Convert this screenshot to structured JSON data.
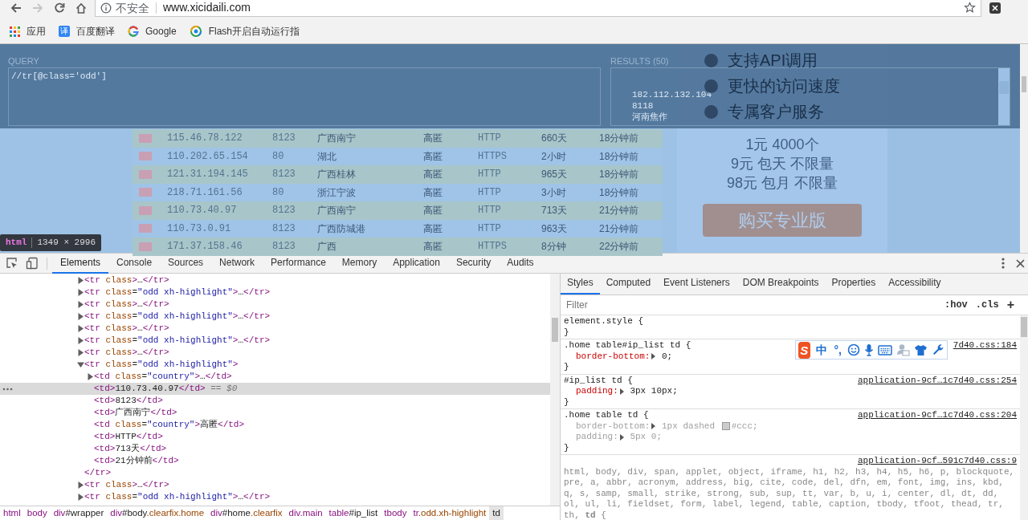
{
  "browser": {
    "nav_buttons": [
      {
        "kind": "back",
        "disabled": false
      },
      {
        "kind": "forward",
        "disabled": true
      },
      {
        "kind": "reload",
        "disabled": false
      },
      {
        "kind": "home",
        "disabled": false
      }
    ],
    "security_label": "不安全",
    "url": "www.xicidaili.com",
    "bookmarks": [
      {
        "kind": "apps",
        "label": "应用"
      },
      {
        "kind": "translate",
        "glyph": "译",
        "label": "百度翻译"
      },
      {
        "kind": "google",
        "label": "Google"
      },
      {
        "kind": "ring",
        "label": "Flash开启自动运行指"
      }
    ]
  },
  "page": {
    "table_rows": [
      {
        "highlighted": true,
        "ip": "115.46.78.122",
        "port": "8123",
        "location": "广西南宁",
        "anonymity": "高匿",
        "type": "HTTP",
        "alive": "660天",
        "verified": "18分钟前"
      },
      {
        "highlighted": false,
        "ip": "110.202.65.154",
        "port": "80",
        "location": "湖北",
        "anonymity": "高匿",
        "type": "HTTPS",
        "alive": "2小时",
        "verified": "18分钟前"
      },
      {
        "highlighted": true,
        "ip": "121.31.194.145",
        "port": "8123",
        "location": "广西桂林",
        "anonymity": "高匿",
        "type": "HTTP",
        "alive": "965天",
        "verified": "18分钟前"
      },
      {
        "highlighted": false,
        "ip": "218.71.161.56",
        "port": "80",
        "location": "浙江宁波",
        "anonymity": "高匿",
        "type": "HTTP",
        "alive": "3小时",
        "verified": "18分钟前"
      },
      {
        "highlighted": true,
        "ip": "110.73.40.97",
        "port": "8123",
        "location": "广西南宁",
        "anonymity": "高匿",
        "type": "HTTP",
        "alive": "713天",
        "verified": "21分钟前"
      },
      {
        "highlighted": false,
        "ip": "110.73.0.91",
        "port": "8123",
        "location": "广西防城港",
        "anonymity": "高匿",
        "type": "HTTP",
        "alive": "963天",
        "verified": "21分钟前"
      },
      {
        "highlighted": true,
        "ip": "171.37.158.46",
        "port": "8123",
        "location": "广西",
        "anonymity": "高匿",
        "type": "HTTPS",
        "alive": "8分钟",
        "verified": "22分钟前"
      }
    ],
    "features": [
      "支持API调用",
      "更快的访问速度",
      "专属客户服务"
    ],
    "prices": [
      "1元 4000个",
      "9元 包天 不限量",
      "98元 包月 不限量"
    ],
    "buy_button": "购买专业版"
  },
  "xpath_helper": {
    "query_label": "QUERY",
    "query": "//tr[@class='odd']",
    "results_label": "RESULTS (50)",
    "results": [
      "182.112.132.104",
      "8118",
      "河南焦作"
    ]
  },
  "inspect_tooltip": {
    "tag": "html",
    "size": "1349 × 2996"
  },
  "devtools": {
    "tabs": [
      {
        "label": "Elements",
        "selected": true
      },
      {
        "label": "Console",
        "selected": false
      },
      {
        "label": "Sources",
        "selected": false
      },
      {
        "label": "Network",
        "selected": false
      },
      {
        "label": "Performance",
        "selected": false
      },
      {
        "label": "Memory",
        "selected": false
      },
      {
        "label": "Application",
        "selected": false
      },
      {
        "label": "Security",
        "selected": false
      },
      {
        "label": "Audits",
        "selected": false
      }
    ],
    "elements_tree": [
      {
        "kind": "parent",
        "expanded": false,
        "selected": false,
        "parts": [
          {
            "kind": "tag",
            "text": "<tr "
          },
          {
            "kind": "attr",
            "text": "class"
          },
          {
            "kind": "tag",
            "text": ">"
          },
          {
            "kind": "text",
            "text": "…"
          },
          {
            "kind": "tag",
            "text": "</tr>"
          }
        ]
      },
      {
        "kind": "parent",
        "expanded": false,
        "selected": false,
        "parts": [
          {
            "kind": "tag",
            "text": "<tr "
          },
          {
            "kind": "attr",
            "text": "class"
          },
          {
            "kind": "text",
            "text": "="
          },
          {
            "kind": "value",
            "text": "\"odd xh-highlight\""
          },
          {
            "kind": "tag",
            "text": ">"
          },
          {
            "kind": "text",
            "text": "…"
          },
          {
            "kind": "tag",
            "text": "</tr>"
          }
        ]
      },
      {
        "kind": "parent",
        "expanded": false,
        "selected": false,
        "parts": [
          {
            "kind": "tag",
            "text": "<tr "
          },
          {
            "kind": "attr",
            "text": "class"
          },
          {
            "kind": "tag",
            "text": ">"
          },
          {
            "kind": "text",
            "text": "…"
          },
          {
            "kind": "tag",
            "text": "</tr>"
          }
        ]
      },
      {
        "kind": "parent",
        "expanded": false,
        "selected": false,
        "parts": [
          {
            "kind": "tag",
            "text": "<tr "
          },
          {
            "kind": "attr",
            "text": "class"
          },
          {
            "kind": "text",
            "text": "="
          },
          {
            "kind": "value",
            "text": "\"odd xh-highlight\""
          },
          {
            "kind": "tag",
            "text": ">"
          },
          {
            "kind": "text",
            "text": "…"
          },
          {
            "kind": "tag",
            "text": "</tr>"
          }
        ]
      },
      {
        "kind": "parent",
        "expanded": false,
        "selected": false,
        "parts": [
          {
            "kind": "tag",
            "text": "<tr "
          },
          {
            "kind": "attr",
            "text": "class"
          },
          {
            "kind": "tag",
            "text": ">"
          },
          {
            "kind": "text",
            "text": "…"
          },
          {
            "kind": "tag",
            "text": "</tr>"
          }
        ]
      },
      {
        "kind": "parent",
        "expanded": false,
        "selected": false,
        "parts": [
          {
            "kind": "tag",
            "text": "<tr "
          },
          {
            "kind": "attr",
            "text": "class"
          },
          {
            "kind": "text",
            "text": "="
          },
          {
            "kind": "value",
            "text": "\"odd xh-highlight\""
          },
          {
            "kind": "tag",
            "text": ">"
          },
          {
            "kind": "text",
            "text": "…"
          },
          {
            "kind": "tag",
            "text": "</tr>"
          }
        ]
      },
      {
        "kind": "parent",
        "expanded": false,
        "selected": false,
        "parts": [
          {
            "kind": "tag",
            "text": "<tr "
          },
          {
            "kind": "attr",
            "text": "class"
          },
          {
            "kind": "tag",
            "text": ">"
          },
          {
            "kind": "text",
            "text": "…"
          },
          {
            "kind": "tag",
            "text": "</tr>"
          }
        ]
      },
      {
        "kind": "parent",
        "expanded": true,
        "selected": false,
        "parts": [
          {
            "kind": "tag",
            "text": "<tr "
          },
          {
            "kind": "attr",
            "text": "class"
          },
          {
            "kind": "text",
            "text": "="
          },
          {
            "kind": "value",
            "text": "\"odd xh-highlight\""
          },
          {
            "kind": "tag",
            "text": ">"
          }
        ],
        "closing": [
          {
            "kind": "tag",
            "text": "</tr>"
          }
        ],
        "children": [
          {
            "kind": "parent",
            "expanded": false,
            "selected": false,
            "parts": [
              {
                "kind": "tag",
                "text": "<td "
              },
              {
                "kind": "attr",
                "text": "class"
              },
              {
                "kind": "text",
                "text": "="
              },
              {
                "kind": "value",
                "text": "\"country\""
              },
              {
                "kind": "tag",
                "text": ">"
              },
              {
                "kind": "text",
                "text": "…"
              },
              {
                "kind": "tag",
                "text": "</td>"
              }
            ]
          },
          {
            "kind": "leaf",
            "selected": true,
            "parts": [
              {
                "kind": "tag",
                "text": "<td>"
              },
              {
                "kind": "text",
                "text": "110.73.40.97"
              },
              {
                "kind": "tag",
                "text": "</td>"
              },
              {
                "kind": "ref",
                "text": " == $0"
              }
            ]
          },
          {
            "kind": "leaf",
            "selected": false,
            "parts": [
              {
                "kind": "tag",
                "text": "<td>"
              },
              {
                "kind": "text",
                "text": "8123"
              },
              {
                "kind": "tag",
                "text": "</td>"
              }
            ]
          },
          {
            "kind": "leaf",
            "selected": false,
            "parts": [
              {
                "kind": "tag",
                "text": "<td>"
              },
              {
                "kind": "text",
                "text": "广西南宁"
              },
              {
                "kind": "tag",
                "text": "</td>"
              }
            ]
          },
          {
            "kind": "leaf",
            "selected": false,
            "parts": [
              {
                "kind": "tag",
                "text": "<td "
              },
              {
                "kind": "attr",
                "text": "class"
              },
              {
                "kind": "text",
                "text": "="
              },
              {
                "kind": "value",
                "text": "\"country\""
              },
              {
                "kind": "tag",
                "text": ">"
              },
              {
                "kind": "text",
                "text": "高匿"
              },
              {
                "kind": "tag",
                "text": "</td>"
              }
            ]
          },
          {
            "kind": "leaf",
            "selected": false,
            "parts": [
              {
                "kind": "tag",
                "text": "<td>"
              },
              {
                "kind": "text",
                "text": "HTTP"
              },
              {
                "kind": "tag",
                "text": "</td>"
              }
            ]
          },
          {
            "kind": "leaf",
            "selected": false,
            "parts": [
              {
                "kind": "tag",
                "text": "<td>"
              },
              {
                "kind": "text",
                "text": "713天"
              },
              {
                "kind": "tag",
                "text": "</td>"
              }
            ]
          },
          {
            "kind": "leaf",
            "selected": false,
            "parts": [
              {
                "kind": "tag",
                "text": "<td>"
              },
              {
                "kind": "text",
                "text": "21分钟前"
              },
              {
                "kind": "tag",
                "text": "</td>"
              }
            ]
          }
        ]
      },
      {
        "kind": "parent",
        "expanded": false,
        "selected": false,
        "parts": [
          {
            "kind": "tag",
            "text": "<tr "
          },
          {
            "kind": "attr",
            "text": "class"
          },
          {
            "kind": "tag",
            "text": ">"
          },
          {
            "kind": "text",
            "text": "…"
          },
          {
            "kind": "tag",
            "text": "</tr>"
          }
        ]
      },
      {
        "kind": "parent",
        "expanded": false,
        "selected": false,
        "parts": [
          {
            "kind": "tag",
            "text": "<tr "
          },
          {
            "kind": "attr",
            "text": "class"
          },
          {
            "kind": "text",
            "text": "="
          },
          {
            "kind": "value",
            "text": "\"odd xh-highlight\""
          },
          {
            "kind": "tag",
            "text": ">"
          },
          {
            "kind": "text",
            "text": "…"
          },
          {
            "kind": "tag",
            "text": "</tr>"
          }
        ]
      }
    ],
    "breadcrumbs": [
      {
        "tag": "html",
        "selected": false
      },
      {
        "tag": "body",
        "selected": false
      },
      {
        "tag": "div",
        "id": "#wrapper",
        "selected": false
      },
      {
        "tag": "div",
        "id": "#body",
        "classes": ".clearfix.home",
        "selected": false
      },
      {
        "tag": "div",
        "id": "#home",
        "classes": ".clearfix",
        "selected": false
      },
      {
        "tag": "div.main",
        "selected": false
      },
      {
        "tag": "table",
        "id": "#ip_list",
        "selected": false
      },
      {
        "tag": "tbody",
        "selected": false
      },
      {
        "tag": "tr",
        "classes": ".odd.xh-highlight",
        "selected": false
      },
      {
        "tag": "td",
        "selected": true
      }
    ],
    "sidebar_tabs": [
      {
        "label": "Styles",
        "selected": true
      },
      {
        "label": "Computed",
        "selected": false
      },
      {
        "label": "Event Listeners",
        "selected": false
      },
      {
        "label": "DOM Breakpoints",
        "selected": false
      },
      {
        "label": "Properties",
        "selected": false
      },
      {
        "label": "Accessibility",
        "selected": false
      }
    ],
    "filter_placeholder": "Filter",
    "hov": ":hov",
    "cls": ".cls",
    "add": "+",
    "style_rules": [
      {
        "dimmed": false,
        "selector": "element.style {",
        "close": "}"
      },
      {
        "dimmed": false,
        "selector": ".home table#ip_list td {",
        "source": "7d40.css:184",
        "declarations": [
          {
            "name": "border-bottom:",
            "value": "0;",
            "overridden": false
          }
        ],
        "close": "}"
      },
      {
        "dimmed": false,
        "selector": "#ip_list td {",
        "source": "application-9cf…1c7d40.css:254",
        "declarations": [
          {
            "name": "padding:",
            "value": "3px 10px;",
            "overridden": false
          }
        ],
        "close": "}"
      },
      {
        "dimmed": false,
        "selector": ".home table td {",
        "source": "application-9cf…1c7d40.css:204",
        "declarations": [
          {
            "name": "border-bottom:",
            "value": "1px dashed ",
            "color": "#cccccc",
            "value_after": "#ccc;",
            "overridden": true
          },
          {
            "name": "padding:",
            "value": "5px 0;",
            "overridden": true
          }
        ],
        "close": "}"
      },
      {
        "dimmed": true,
        "selector": "html, body, div, span, applet, object, iframe, h1, h2, h3, h4, h5, h6, p, blockquote, pre, a, abbr, acronym, address, big, cite, code, del, dfn, em, font, img, ins, kbd, q, s, samp, small, strike, strong, sub, sup, tt, var, b, u, i, center, dl, dt, dd, ol, ul, li, fieldset, form, label, legend, table, caption, tbody, tfoot, thead, tr, th, **td** {",
        "source": "application-9cf…591c7d40.css:9"
      }
    ]
  },
  "ime_toolbar": {
    "logo": "S",
    "mode": "中",
    "punctuation": "°,"
  }
}
